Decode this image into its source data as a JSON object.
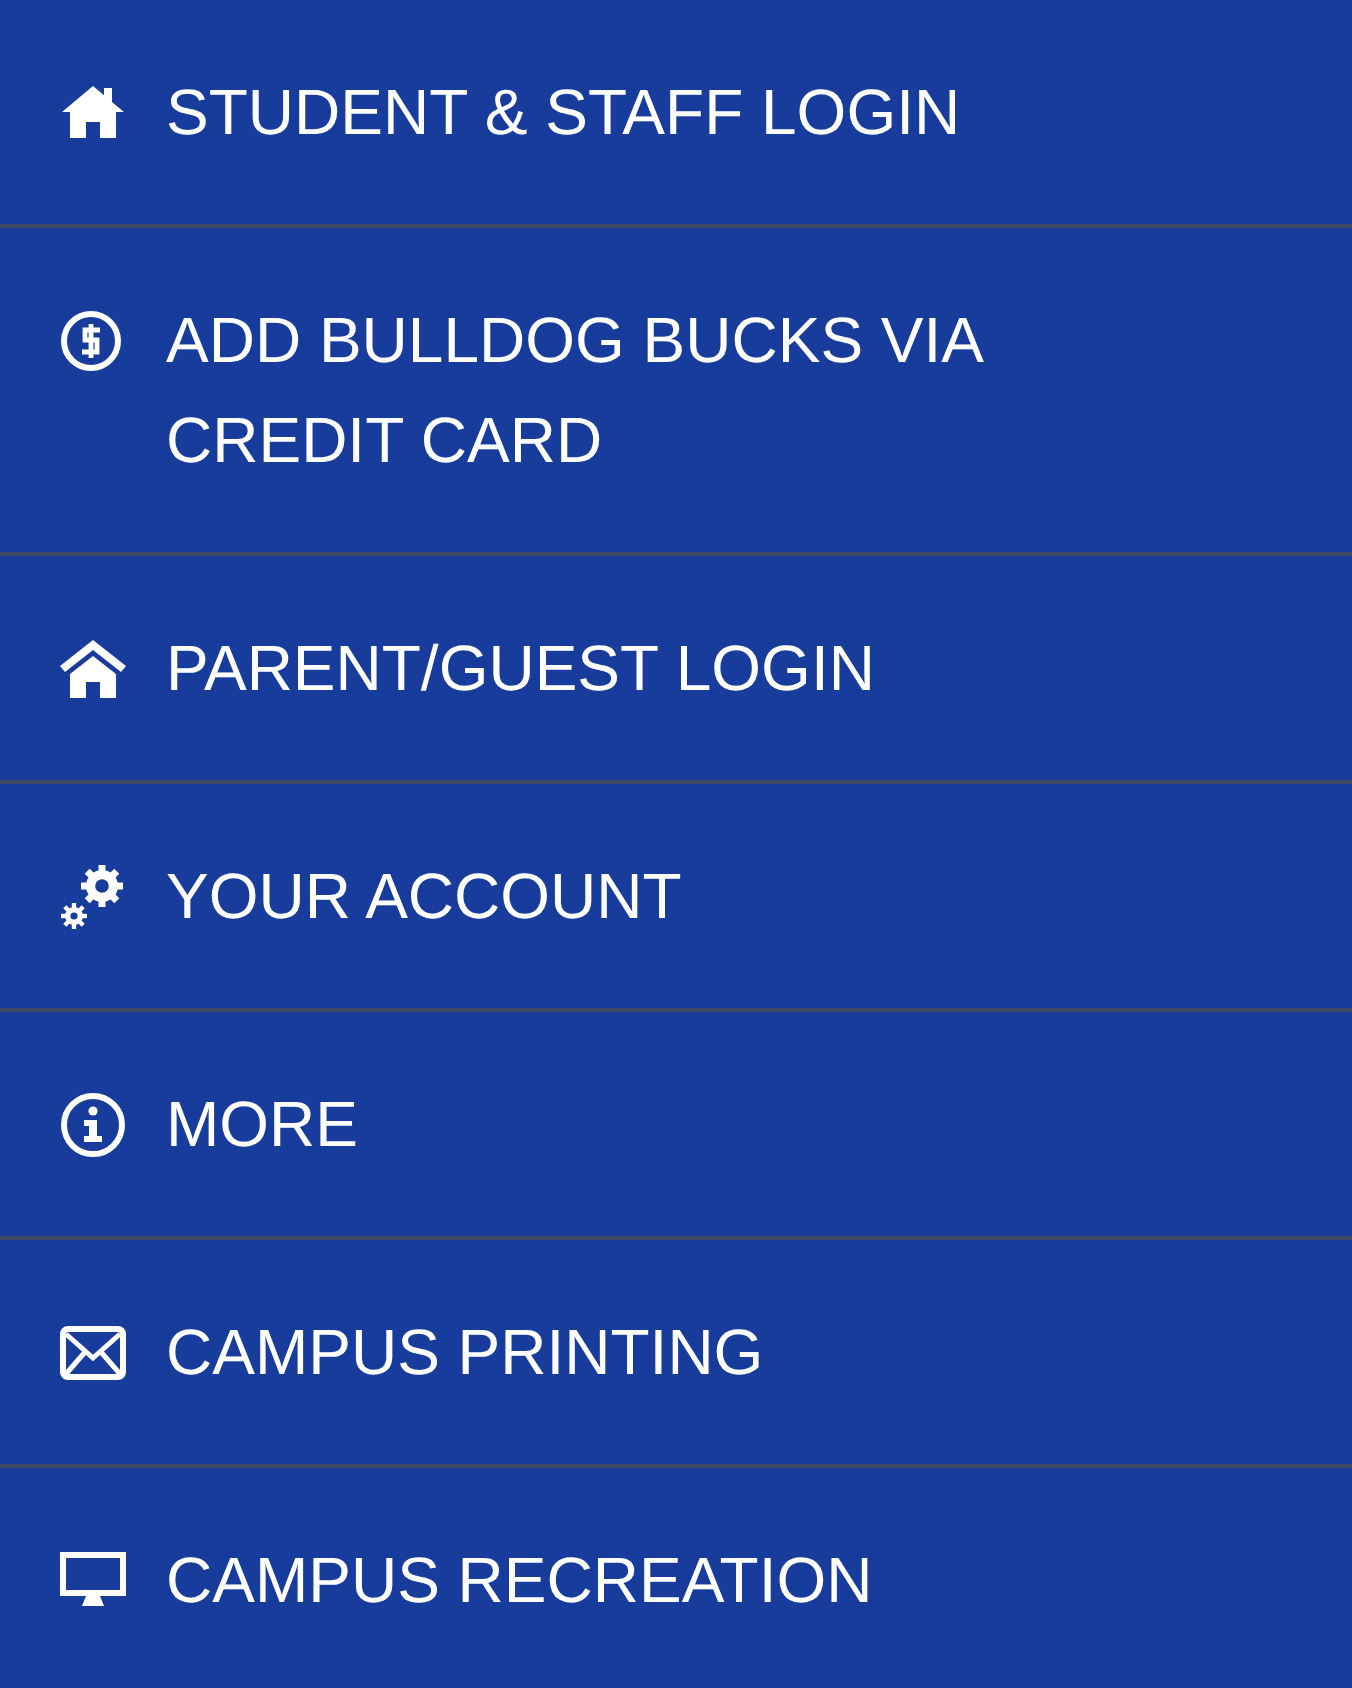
{
  "menu": {
    "items": [
      {
        "label": "STUDENT & STAFF LOGIN"
      },
      {
        "label": "ADD BULLDOG BUCKS VIA CREDIT CARD"
      },
      {
        "label": "PARENT/GUEST LOGIN"
      },
      {
        "label": "YOUR ACCOUNT"
      },
      {
        "label": "MORE"
      },
      {
        "label": "CAMPUS PRINTING"
      },
      {
        "label": "CAMPUS RECREATION"
      }
    ]
  }
}
